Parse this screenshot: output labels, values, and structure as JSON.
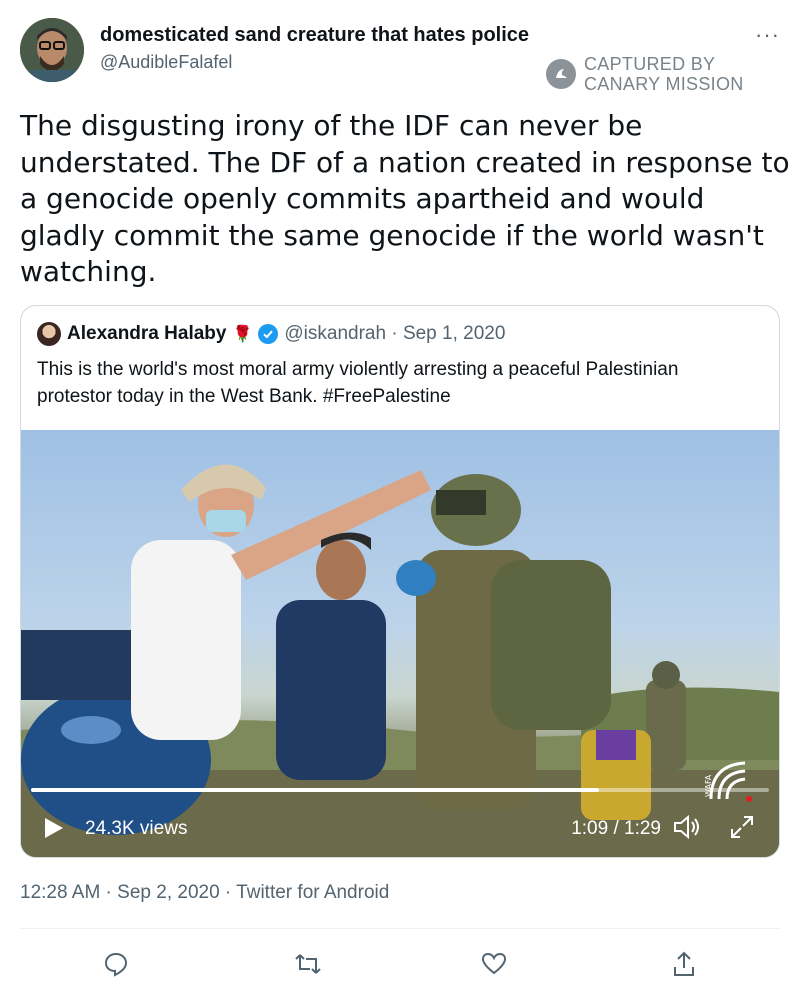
{
  "author": {
    "display_name": "domesticated sand creature that hates police",
    "handle": "@AudibleFalafel",
    "avatar_icon": "avatar-photo"
  },
  "more_label": "···",
  "watermark": {
    "line1": "CAPTURED BY",
    "line2": "CANARY MISSION",
    "icon": "canary-mission-logo"
  },
  "tweet": {
    "text": "The disgusting irony of the IDF can never be understated. The DF of a nation created in response to a genocide openly commits apartheid and would gladly commit the same genocide if the world wasn't watching."
  },
  "quoted_tweet": {
    "name": "Alexandra Halaby",
    "name_emoji": "🌹",
    "verified": true,
    "handle_and_date": "@iskandrah · Sep 1, 2020",
    "text": "This is the world's most moral army violently arresting a peaceful Palestinian protestor today in the West Bank. #FreePalestine",
    "video": {
      "views": "24.3K views",
      "time": "1:09 / 1:29",
      "progress": 0.77,
      "logo": "wafa-logo"
    }
  },
  "timestamp": "12:28 AM · Sep 2, 2020 · Twitter for Android",
  "actions": [
    "reply-icon",
    "retweet-icon",
    "like-icon",
    "share-icon"
  ],
  "colors": {
    "accent": "#1d9bf0",
    "secondary_text": "#536471",
    "border": "#cfd9de"
  }
}
